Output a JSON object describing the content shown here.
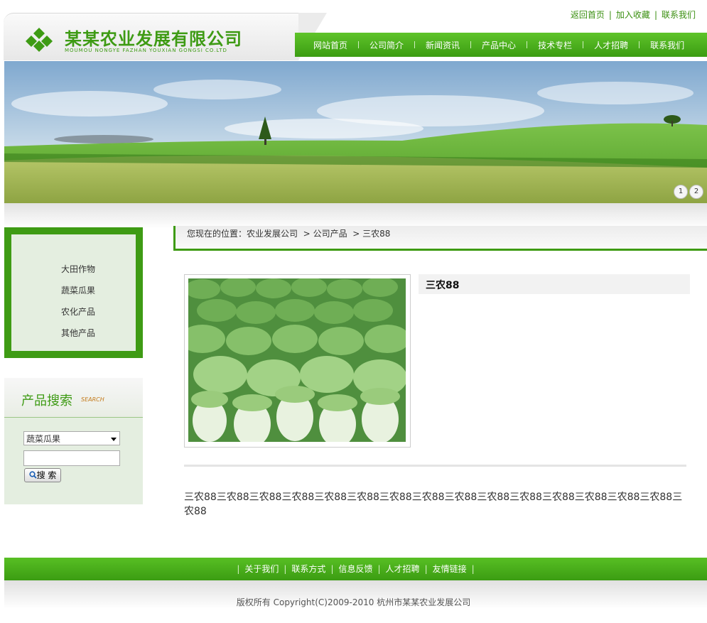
{
  "top_links": [
    "返回首页",
    "加入收藏",
    "联系我们"
  ],
  "logo": {
    "cn": "某某农业发展有限公司",
    "en": "MOUMOU NONGYE FAZHAN YOUXIAN GONGSI CO.LTD"
  },
  "nav": [
    "网站首页",
    "公司简介",
    "新闻资讯",
    "产品中心",
    "技术专栏",
    "人才招聘",
    "联系我们"
  ],
  "banner_pages": [
    "1",
    "2"
  ],
  "categories": [
    "大田作物",
    "蔬菜瓜果",
    "农化产品",
    "其他产品"
  ],
  "search": {
    "title": "产品搜索",
    "subtitle": "SEARCH",
    "selected": "蔬菜瓜果",
    "keyword": "",
    "button": "搜 索"
  },
  "breadcrumb": {
    "label": "您现在的位置：",
    "items": [
      "农业发展公司",
      "公司产品",
      "三农88"
    ],
    "sep": ">"
  },
  "product": {
    "title": "三农88",
    "description": "三农88三农88三农88三农88三农88三农88三农88三农88三农88三农88三农88三农88三农88三农88三农88三农88"
  },
  "footer_nav": [
    "关于我们",
    "联系方式",
    "信息反馈",
    "人才招聘",
    "友情链接"
  ],
  "copyright": "版权所有  Copyright(C)2009-2010 杭州市某某农业发展公司",
  "colors": {
    "brand_green": "#3e9b14",
    "nav_green": "#5fc42a"
  }
}
